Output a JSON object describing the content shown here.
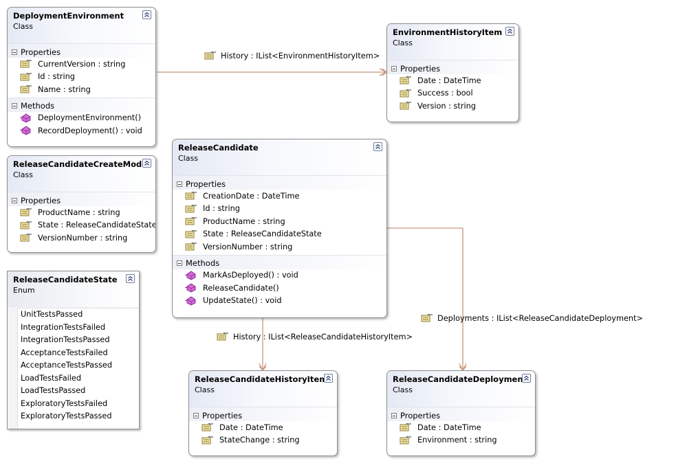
{
  "diagram": {
    "classes": {
      "deployment_environment": {
        "name": "DeploymentEnvironment",
        "kind": "Class",
        "properties_label": "Properties",
        "properties": [
          "CurrentVersion : string",
          "Id : string",
          "Name : string"
        ],
        "methods_label": "Methods",
        "methods": [
          "DeploymentEnvironment()",
          "RecordDeployment() : void"
        ]
      },
      "environment_history_item": {
        "name": "EnvironmentHistoryItem",
        "kind": "Class",
        "properties_label": "Properties",
        "properties": [
          "Date : DateTime",
          "Success : bool",
          "Version : string"
        ]
      },
      "release_candidate_create_model": {
        "name": "ReleaseCandidateCreateModel",
        "kind": "Class",
        "properties_label": "Properties",
        "properties": [
          "ProductName : string",
          "State : ReleaseCandidateState",
          "VersionNumber : string"
        ]
      },
      "release_candidate": {
        "name": "ReleaseCandidate",
        "kind": "Class",
        "properties_label": "Properties",
        "properties": [
          "CreationDate : DateTime",
          "Id : string",
          "ProductName : string",
          "State : ReleaseCandidateState",
          "VersionNumber : string"
        ],
        "methods_label": "Methods",
        "methods": [
          "MarkAsDeployed() : void",
          "ReleaseCandidate()",
          "UpdateState() : void"
        ]
      },
      "release_candidate_state": {
        "name": "ReleaseCandidateState",
        "kind": "Enum",
        "values": [
          "UnitTestsPassed",
          "IntegrationTestsFailed",
          "IntegrationTestsPassed",
          "AcceptanceTestsFailed",
          "AcceptanceTestsPassed",
          "LoadTestsFailed",
          "LoadTestsPassed",
          "ExploratoryTestsFailed",
          "ExploratoryTestsPassed"
        ]
      },
      "release_candidate_history_item": {
        "name": "ReleaseCandidateHistoryItem",
        "kind": "Class",
        "properties_label": "Properties",
        "properties": [
          "Date : DateTime",
          "StateChange : string"
        ]
      },
      "release_candidate_deployment": {
        "name": "ReleaseCandidateDeployment",
        "kind": "Class",
        "properties_label": "Properties",
        "properties": [
          "Date : DateTime",
          "Environment : string"
        ]
      }
    },
    "associations": {
      "environment_history": "History : IList<EnvironmentHistoryItem>",
      "candidate_history": "History : IList<ReleaseCandidateHistoryItem>",
      "candidate_deployments": "Deployments : IList<ReleaseCandidateDeployment>"
    },
    "icons": {
      "property": "property-icon",
      "method": "method-icon",
      "collapse": "collapse-chevron-icon",
      "association": "association-property-icon"
    },
    "colors": {
      "connector": "#c7967c",
      "header_gradient_start": "#e4e9f4",
      "border": "#8c8c8c",
      "method_icon": "#c040c8"
    }
  }
}
